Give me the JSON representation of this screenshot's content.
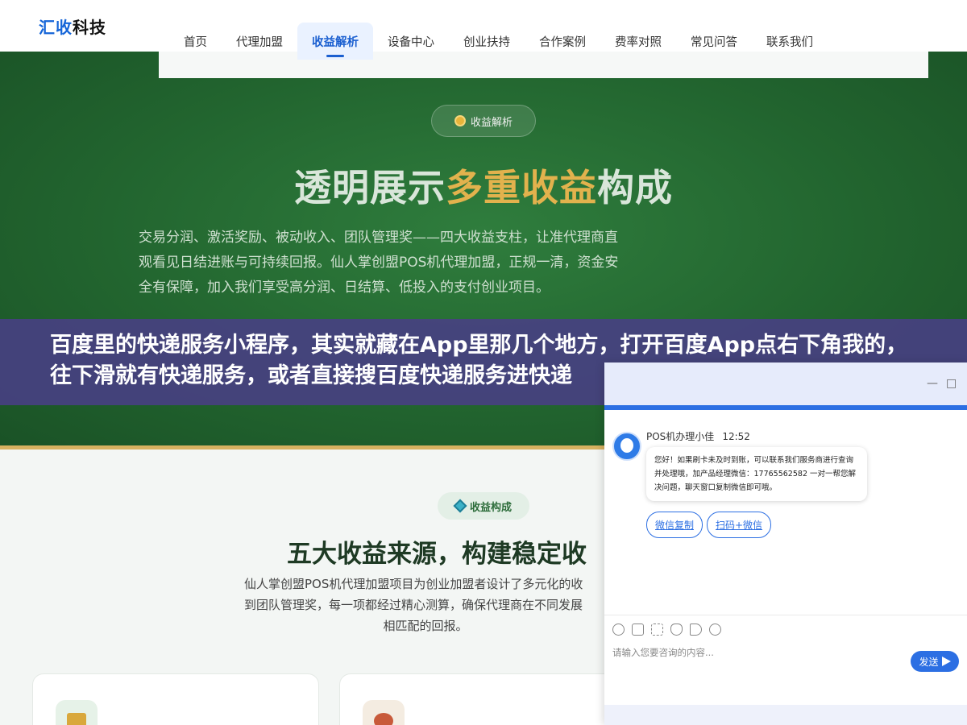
{
  "header": {
    "logo_accent": "汇收",
    "logo_rest": "科技",
    "nav": [
      {
        "label": "首页"
      },
      {
        "label": "代理加盟"
      },
      {
        "label": "收益解析"
      },
      {
        "label": "设备中心"
      },
      {
        "label": "创业扶持"
      },
      {
        "label": "合作案例"
      },
      {
        "label": "费率对照"
      },
      {
        "label": "常见问答"
      },
      {
        "label": "联系我们"
      }
    ],
    "active_nav": "收益解析"
  },
  "hero": {
    "badge": "收益解析",
    "title_part1": "透明展示",
    "title_highlight": "多重收益",
    "title_part2": "构成",
    "description": "交易分润、激活奖励、被动收入、团队管理奖——四大收益支柱，让准代理商直观看见日结进账与可持续回报。仙人掌创盟POS机代理加盟，正规一清，资金安全有保障，加入我们享受高分润、日结算、低投入的支付创业项目。"
  },
  "banner": {
    "text": "百度里的快递服务小程序，其实就藏在App里那几个地方，打开百度App点右下角我的，往下滑就有快递服务，或者直接搜百度快递服务进快递"
  },
  "section2": {
    "badge": "收益构成",
    "title": "五大收益来源，构建稳定收",
    "description_line1": "仙人掌创盟POS机代理加盟项目为创业加盟者设计了多元化的收",
    "description_line2": "到团队管理奖，每一项都经过精心测算，确保代理商在不同发展",
    "description_line3": "相匹配的回报。"
  },
  "chat": {
    "minimize": "—",
    "maximize": "□",
    "agent_name": "POS机办理小佳",
    "time": "12:52",
    "message": "您好！如果刷卡未及时到账，可以联系我们服务商进行查询并处理哦，加产品经理微信：17765562582 一对一帮您解决问题，聊天窗口复制微信即可哦。",
    "quick_replies": [
      "微信复制",
      "扫码+微信"
    ],
    "input_placeholder": "请输入您要咨询的内容...",
    "send_label": "发送"
  },
  "colors": {
    "brand_blue": "#1565d8",
    "hero_green": "#22652f",
    "gold": "#e2b24d",
    "banner_purple": "#493f85"
  }
}
